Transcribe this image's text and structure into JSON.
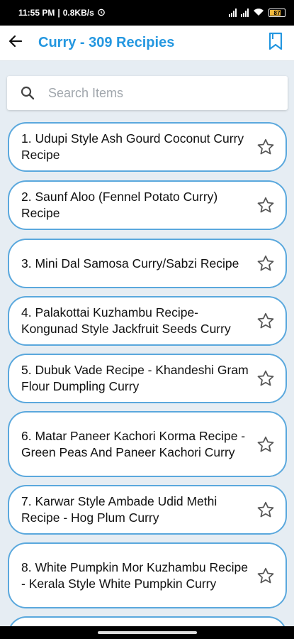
{
  "status_bar": {
    "time": "11:55 PM",
    "speed": "0.8KB/s",
    "battery_level": "87"
  },
  "app_bar": {
    "title": "Curry - 309 Recipies",
    "back_icon": "arrow-left-icon",
    "bookmark_icon": "bookmark-icon"
  },
  "search": {
    "placeholder": "Search Items",
    "value": ""
  },
  "recipes": [
    {
      "label": "1. Udupi Style Ash Gourd Coconut Curry Recipe"
    },
    {
      "label": "2. Saunf Aloo (Fennel Potato Curry) Recipe"
    },
    {
      "label": "3. Mini Dal Samosa Curry/Sabzi Recipe"
    },
    {
      "label": "4. Palakottai Kuzhambu Recipe-Kongunad Style Jackfruit Seeds Curry"
    },
    {
      "label": "5. Dubuk Vade Recipe - Khandeshi Gram Flour Dumpling Curry"
    },
    {
      "label": "6. Matar Paneer Kachori Korma Recipe - Green Peas And Paneer Kachori Curry"
    },
    {
      "label": "7. Karwar Style Ambade Udid Methi Recipe - Hog Plum Curry"
    },
    {
      "label": "8. White Pumpkin Mor Kuzhambu Recipe - Kerala Style White Pumpkin Curry"
    }
  ],
  "colors": {
    "accent": "#2497e0",
    "card_border": "#5aa8dd",
    "background": "#e6edf3"
  }
}
